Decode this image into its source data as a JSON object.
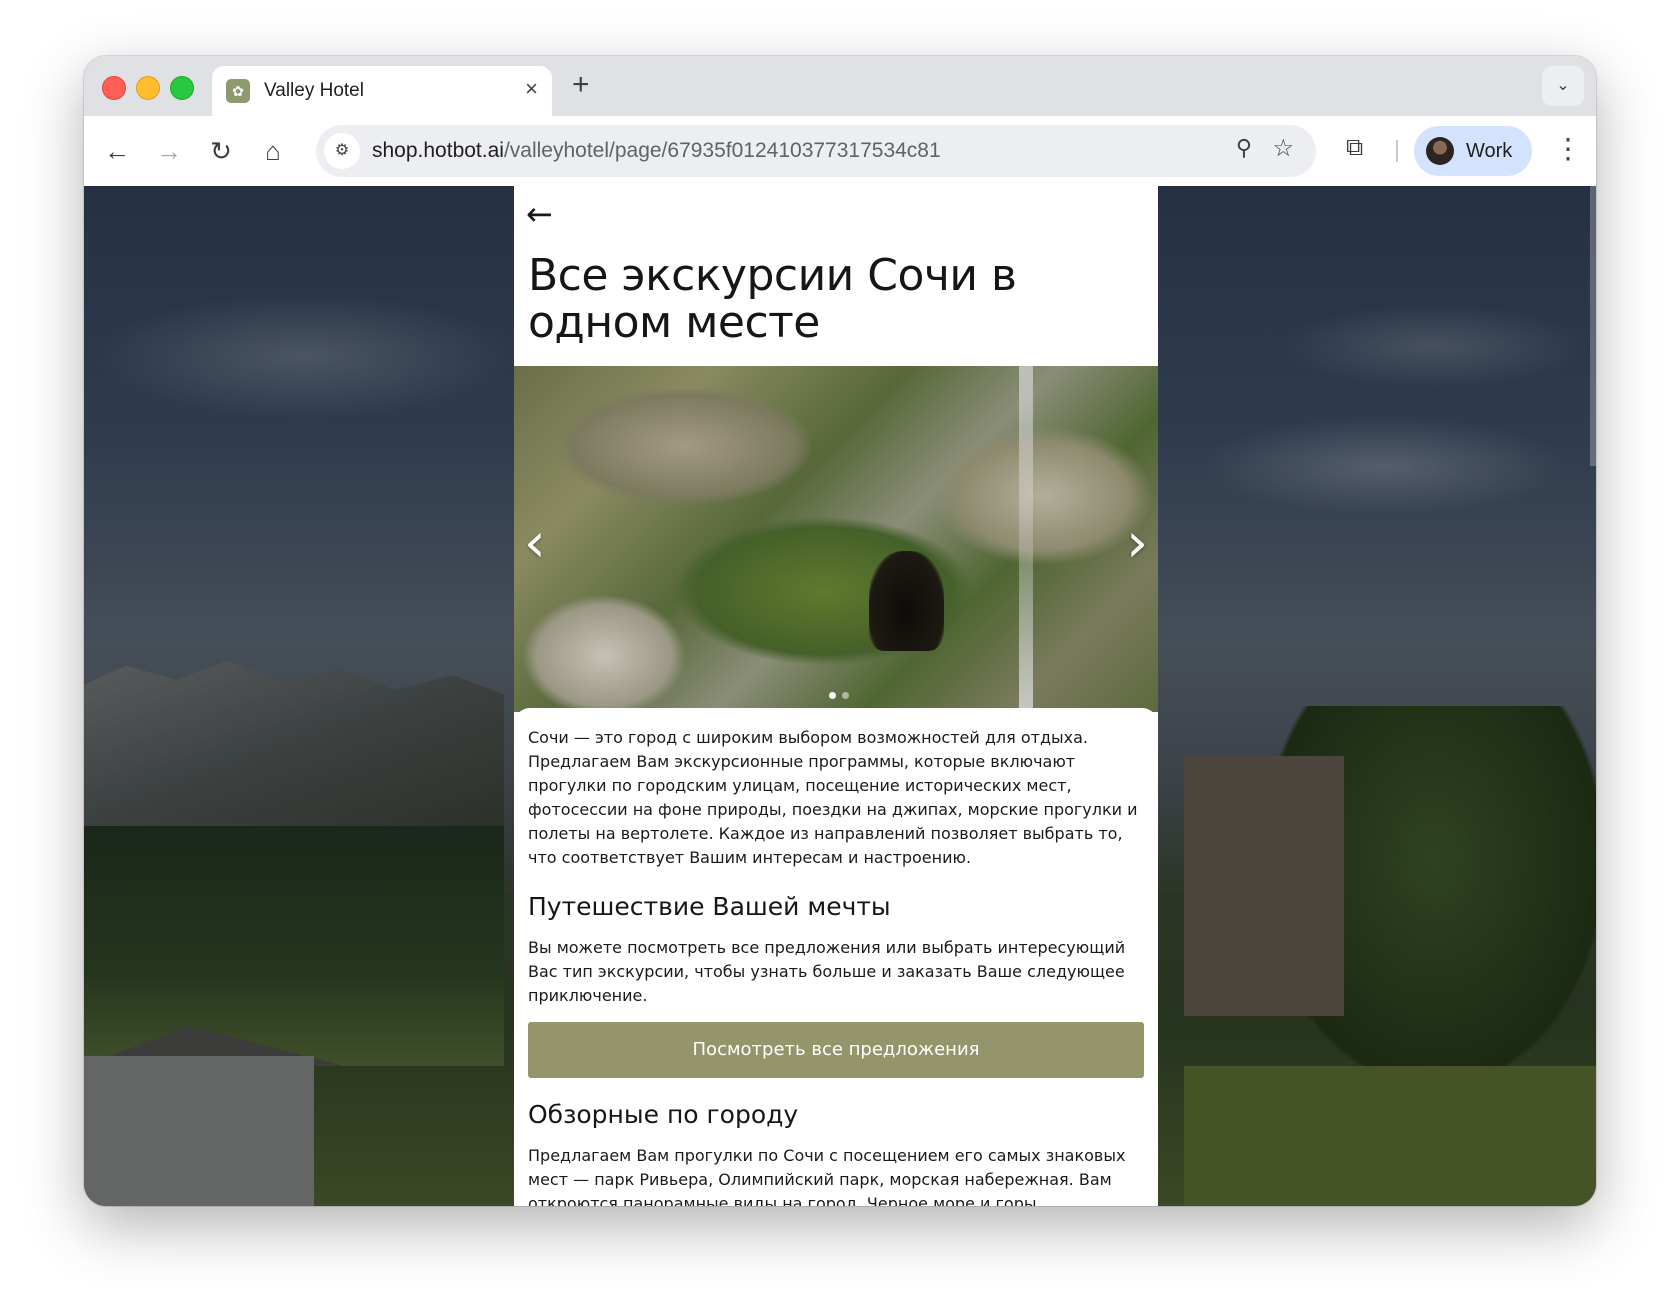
{
  "browser": {
    "tab_title": "Valley Hotel",
    "favicon": "valley-hotel-logo",
    "new_tab": "+",
    "close": "×",
    "url_host": "shop.hotbot.ai",
    "url_path": "/valleyhotel/page/67935f012410377317534c81",
    "profile_label": "Work"
  },
  "page": {
    "title": "Все экскурсии Сочи в одном месте",
    "intro": "Сочи — это город с широким выбором возможностей для отдыха. Предлагаем Вам экскурсионные программы, которые включают прогулки по городским улицам, посещение исторических мест, фотосессии на фоне природы, поездки на джипах, морские прогулки и полеты на вертолете. Каждое из направлений позволяет выбрать то, что соответствует Вашим интересам и настроению.",
    "section1_title": "Путешествие Вашей мечты",
    "section1_text": "Вы можете посмотреть все предложения или выбрать интересующий Вас тип экскурсии, чтобы узнать больше и заказать Ваше следующее приключение.",
    "cta_label": "Посмотреть все предложения",
    "section2_title": "Обзорные по городу",
    "section2_text": "Предлагаем Вам прогулки по Сочи с посещением его самых знаковых мест — парк Ривьера, Олимпийский парк, морская набережная. Вам откроются панорамные виды на город. Черное море и горы."
  },
  "carousel": {
    "slide_count": 2,
    "active_index": 0
  },
  "colors": {
    "cta": "#94956b",
    "profile_chip": "#d3e3fd"
  }
}
